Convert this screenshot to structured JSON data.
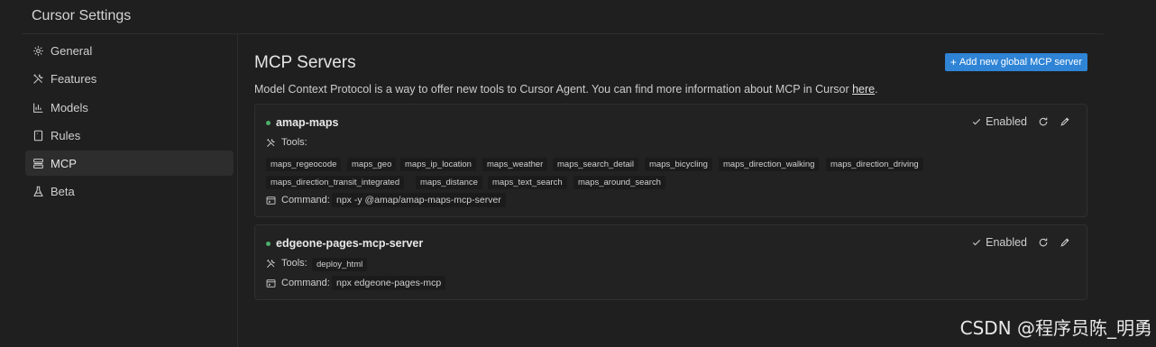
{
  "window": {
    "title": "Cursor Settings"
  },
  "sidebar": {
    "items": [
      {
        "label": "General",
        "icon": "gear-icon"
      },
      {
        "label": "Features",
        "icon": "tools-icon"
      },
      {
        "label": "Models",
        "icon": "bar-chart-icon"
      },
      {
        "label": "Rules",
        "icon": "document-icon"
      },
      {
        "label": "MCP",
        "icon": "server-icon",
        "active": true
      },
      {
        "label": "Beta",
        "icon": "flask-icon"
      }
    ]
  },
  "main": {
    "title": "MCP Servers",
    "add_button_label": "Add new global MCP server",
    "description": "Model Context Protocol is a way to offer new tools to Cursor Agent. You can find more information about MCP in Cursor ",
    "description_link": "here",
    "description_end": "."
  },
  "servers": [
    {
      "name": "amap-maps",
      "status": "Enabled",
      "tools_label": "Tools:",
      "tools": [
        "maps_regeocode",
        "maps_geo",
        "maps_ip_location",
        "maps_weather",
        "maps_search_detail",
        "maps_bicycling",
        "maps_direction_walking",
        "maps_direction_driving",
        "maps_direction_transit_integrated",
        "maps_distance",
        "maps_text_search",
        "maps_around_search"
      ],
      "command_label": "Command:",
      "command": "npx -y @amap/amap-maps-mcp-server"
    },
    {
      "name": "edgeone-pages-mcp-server",
      "status": "Enabled",
      "tools_label": "Tools:",
      "tools": [
        "deploy_html"
      ],
      "command_label": "Command:",
      "command": "npx edgeone-pages-mcp"
    }
  ],
  "watermark": "CSDN @程序员陈_明勇",
  "colors": {
    "accent": "#2f84d6",
    "status_dot": "#4caf6a",
    "background": "#1f1f1f",
    "card": "#222222"
  }
}
